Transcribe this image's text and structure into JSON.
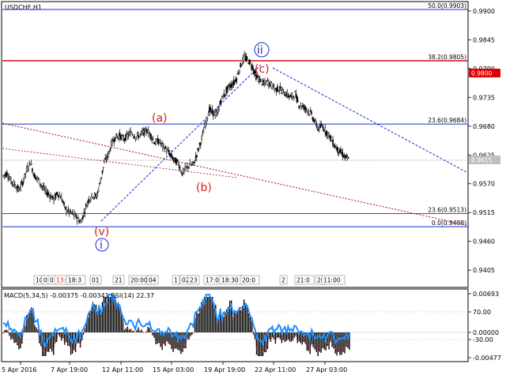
{
  "chart": {
    "symbol": "USDCHF,H1",
    "indicator_caption": "MACD(5,34,5) -0.00375 -0.00341 RSI(14) 22.37"
  },
  "price_axis": {
    "ticks": [
      "0.9900",
      "0.9845",
      "0.9790",
      "0.9735",
      "0.9680",
      "0.9625",
      "0.9570",
      "0.9515",
      "0.9460",
      "0.9405"
    ],
    "current_price": "0.9615",
    "highlight_price": "0.9800"
  },
  "indicator_axis": {
    "ticks": [
      "0.00693",
      "70.00",
      "0.00000",
      "-30.00",
      "-0.00477"
    ]
  },
  "time_axis": {
    "labels": [
      "5 Apr 2016",
      "7 Apr 19:00",
      "12 Apr 11:00",
      "15 Apr 03:00",
      "19 Apr 19:00",
      "22 Apr 11:00",
      "27 Apr 03:00"
    ]
  },
  "session_marks": {
    "labels": [
      "10",
      "0",
      "0",
      "13:00",
      "18:3",
      "01",
      "21",
      "20:00",
      "04",
      "1",
      "02",
      "23",
      "17:0",
      "18:30",
      "20:0",
      "2",
      "21:0",
      "20",
      "11:00"
    ]
  },
  "fib_levels": [
    {
      "label": "50.0(0.9903)",
      "price": 0.9903,
      "color": "#1a2bd0"
    },
    {
      "label": "38.2(0.9805)",
      "price": 0.9805,
      "color": "#d42020"
    },
    {
      "label": "23.6(0.9684)",
      "price": 0.9684,
      "color": "#1a2bd0"
    },
    {
      "label": "23.6(0.9513)",
      "price": 0.9513,
      "color": "#d42020"
    },
    {
      "label": "0.0(0.9488)",
      "price": 0.9488,
      "color": "#1a2bd0"
    }
  ],
  "wave_labels": {
    "a": "(a)",
    "b": "(b)",
    "c": "(c)",
    "v": "(v)",
    "i": "i",
    "ii": "ii"
  },
  "chart_data": {
    "type": "line",
    "series": [
      {
        "values": [
          0.9585,
          0.959,
          0.9575,
          0.9568,
          0.9558,
          0.9572,
          0.9595,
          0.9612,
          0.9586,
          0.9578,
          0.9565,
          0.9555,
          0.9548,
          0.954,
          0.9552,
          0.9543,
          0.9522,
          0.9515,
          0.9512,
          0.9505,
          0.9496,
          0.952,
          0.954,
          0.9548,
          0.9545,
          0.9575,
          0.961,
          0.9625,
          0.965,
          0.966,
          0.9662,
          0.9655,
          0.9662,
          0.9668,
          0.966,
          0.9662,
          0.9668,
          0.9672,
          0.9662,
          0.9648,
          0.9652,
          0.9642,
          0.9635,
          0.9625,
          0.9615,
          0.961,
          0.959,
          0.96,
          0.9605,
          0.9608,
          0.9632,
          0.9655,
          0.9685,
          0.9712,
          0.9705,
          0.9702,
          0.973,
          0.9742,
          0.9755,
          0.976,
          0.9772,
          0.9795,
          0.9812,
          0.9805,
          0.9795,
          0.9775,
          0.9768,
          0.976,
          0.9765,
          0.9758,
          0.975,
          0.9752,
          0.9745,
          0.974,
          0.9735,
          0.9742,
          0.9722,
          0.9718,
          0.9712,
          0.9705,
          0.969,
          0.9675,
          0.968,
          0.967,
          0.966,
          0.9645,
          0.9635,
          0.9628,
          0.962,
          0.9615
        ]
      }
    ],
    "ylim": [
      0.9372,
      0.9918
    ]
  },
  "colors": {
    "candles": "#000000",
    "rsi": "#1e90ff",
    "macd_hist": "#000000",
    "macd_signal": "#d42020",
    "fib_blue": "#1a2bd0",
    "fib_red": "#d42020",
    "trend_red": "#a01010",
    "trend_blue": "#1a2bd0",
    "price_marker": "#e00000"
  }
}
